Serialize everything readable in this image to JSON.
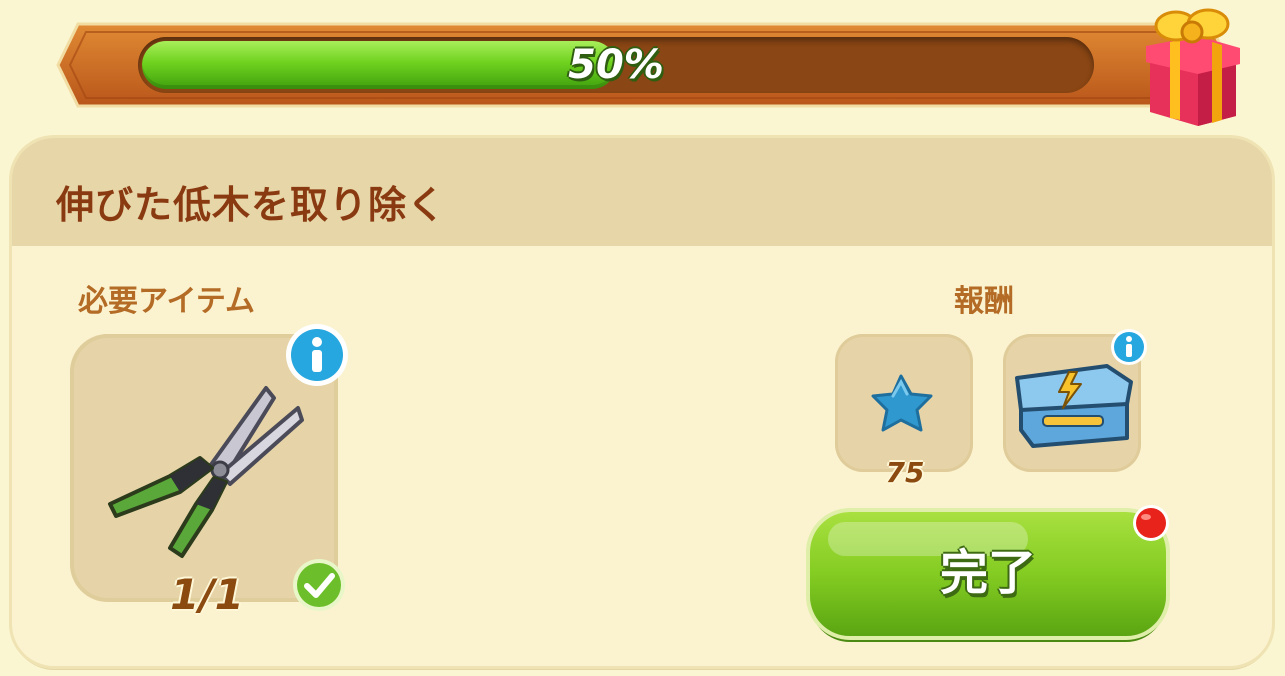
{
  "progress": {
    "label": "50%",
    "fraction": 0.5
  },
  "panel": {
    "title": "伸びた低木を取り除く",
    "required_label": "必要アイテム",
    "reward_label": "報酬"
  },
  "required_item": {
    "icon": "pruning-shears-icon",
    "count_text": "1/1",
    "completed": true
  },
  "rewards": [
    {
      "icon": "blue-star-icon",
      "amount": "75"
    },
    {
      "icon": "energy-chest-icon"
    }
  ],
  "actions": {
    "complete_label": "完了"
  },
  "colors": {
    "progress_fill": "#6fd21e",
    "banner": "#c9661e",
    "title_text": "#8a3a10",
    "button": "#84cc22",
    "notification": "#e8231c"
  }
}
